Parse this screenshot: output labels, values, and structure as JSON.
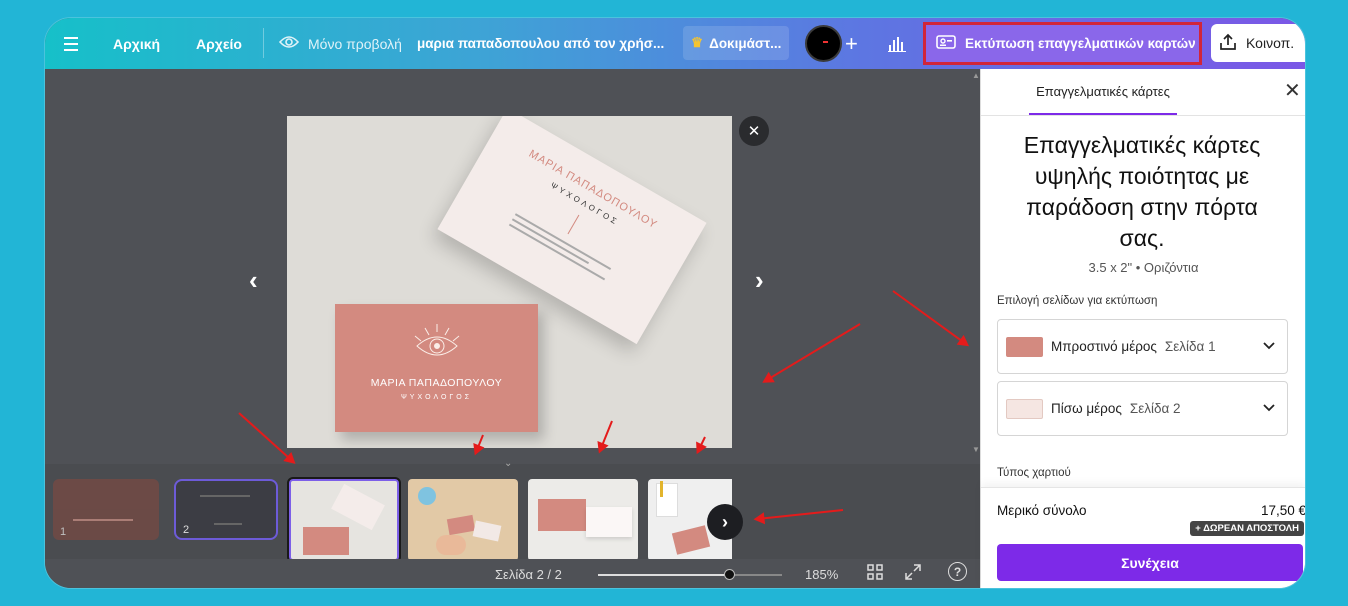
{
  "topbar": {
    "menu_icon": "menu-icon",
    "home": "Αρχική",
    "file": "Αρχείο",
    "view_only": "Μόνο προβολή",
    "doc_title": "μαρια παπαδοπουλου από τον χρήσ...",
    "trial": "Δοκιμάστ...",
    "print_cards": "Εκτύπωση επαγγελματικών καρτών",
    "share": "Κοινοπ."
  },
  "preview": {
    "card_front_name": "ΜΑΡΙΑ ΠΑΠΑΔΟΠΟΥΛΟΥ",
    "card_front_title": "ΨΥΧΟΛΟΓΟΣ",
    "card_back_name": "ΜΑΡΙΑ ΠΑΠΑΔΟΠΟΥΛΟΥ",
    "card_back_title": "ΨΥΧΟΛΟΓΟΣ"
  },
  "thumbnails": [
    {
      "label": "1"
    },
    {
      "label": "2"
    }
  ],
  "bottombar": {
    "page_indicator": "Σελίδα 2 / 2",
    "zoom": "185%",
    "zoom_level": 0.72
  },
  "panel": {
    "tab": "Επαγγελματικές κάρτες",
    "heading": "Επαγγελματικές κάρτες υψηλής ποιότητας με παράδοση στην πόρτα σας.",
    "size": "3.5 x 2\" • Οριζόντια",
    "pages_label": "Επιλογή σελίδων για εκτύπωση",
    "front_label": "Μπροστινό μέρος",
    "front_page": "Σελίδα 1",
    "back_label": "Πίσω μέρος",
    "back_page": "Σελίδα 2",
    "paper_type": "Τύπος χαρτιού",
    "subtotal_label": "Μερικό σύνολο",
    "subtotal_value": "17,50 €",
    "free_shipping": "+ ΔΩΡΕΑΝ ΑΠΟΣΤΟΛΗ",
    "continue": "Συνέχεια"
  },
  "colors": {
    "accent": "#7d2ae8",
    "highlight": "#d1253a",
    "card_pink": "#d38a80"
  }
}
